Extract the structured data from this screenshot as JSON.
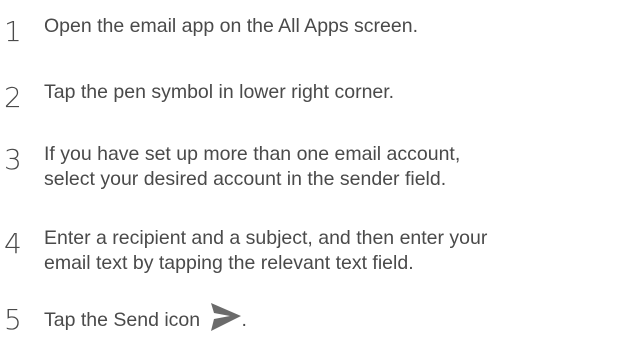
{
  "steps": [
    {
      "number": "1",
      "lines": [
        "Open the email app on the All Apps screen."
      ]
    },
    {
      "number": "2",
      "lines": [
        "Tap the pen symbol in lower right corner."
      ]
    },
    {
      "number": "3",
      "lines": [
        "If you have set up more than one email account,",
        "select your desired account in the sender field."
      ]
    },
    {
      "number": "4",
      "lines": [
        "Enter a recipient and a subject, and then enter your",
        "email text by tapping the relevant text field."
      ]
    },
    {
      "number": "5",
      "text_before_icon": "Tap the Send icon",
      "text_after_icon": ".",
      "icon": "send-icon"
    }
  ],
  "colors": {
    "text": "#4a4a4a",
    "icon": "#6b6b6b"
  }
}
